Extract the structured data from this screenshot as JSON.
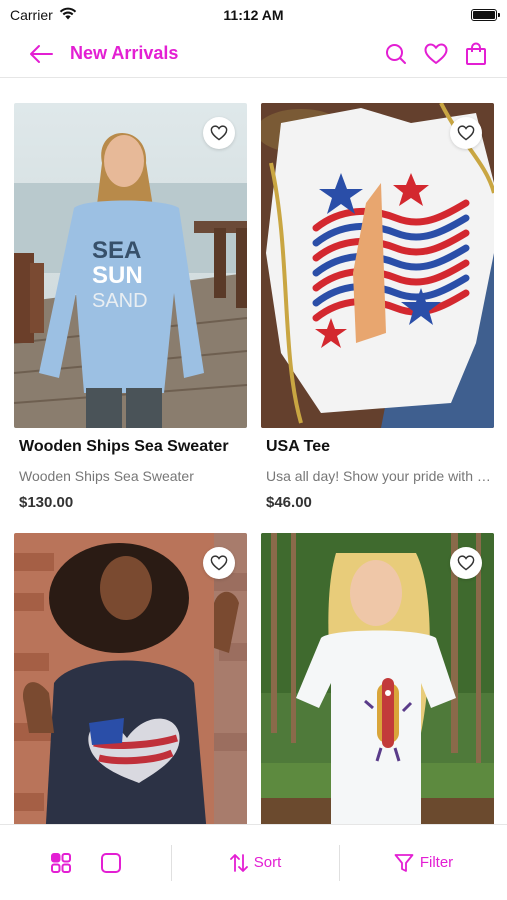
{
  "status": {
    "carrier": "Carrier",
    "time": "11:12 AM",
    "battery_level": 1.0
  },
  "header": {
    "title": "New Arrivals"
  },
  "products": [
    {
      "name": "Wooden Ships Sea Sweater",
      "description": "Wooden Ships Sea Sweater",
      "price": "$130.00",
      "graphic_text": [
        "SEA",
        "SUN",
        "SAND"
      ]
    },
    {
      "name": "USA Tee",
      "description": "Usa all day! Show your pride with this tee",
      "price": "$46.00"
    },
    {
      "name": "",
      "description": "",
      "price": ""
    },
    {
      "name": "",
      "description": "",
      "price": ""
    }
  ],
  "bottom": {
    "sort_label": "Sort",
    "filter_label": "Filter"
  },
  "colors": {
    "accent": "#e31fd3"
  }
}
